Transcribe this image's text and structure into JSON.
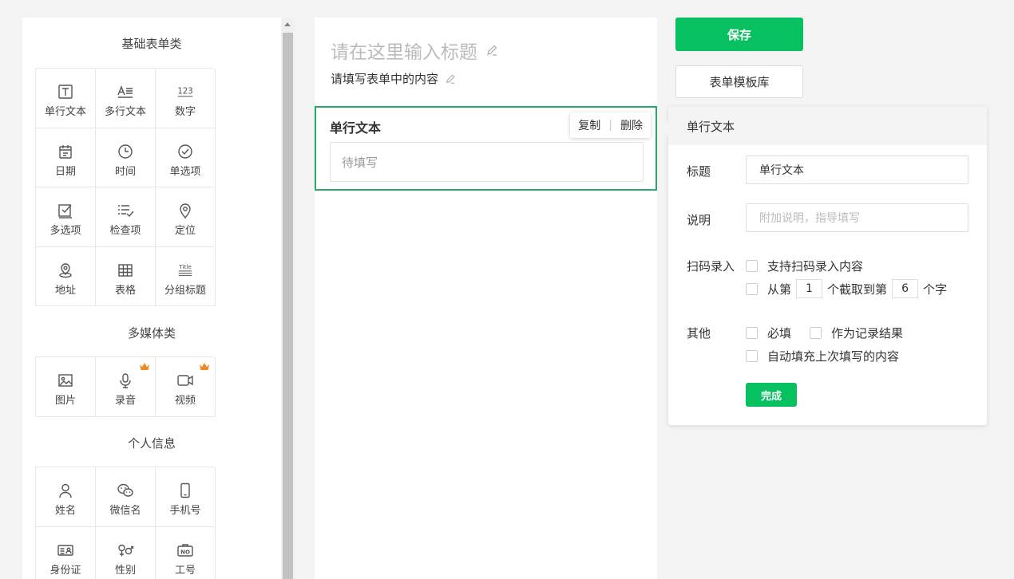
{
  "palette": {
    "sections": [
      {
        "title": "基础表单类",
        "items": [
          {
            "label": "单行文本",
            "icon": "text-box-icon"
          },
          {
            "label": "多行文本",
            "icon": "multiline-text-icon"
          },
          {
            "label": "数字",
            "icon": "number-icon"
          },
          {
            "label": "日期",
            "icon": "calendar-icon"
          },
          {
            "label": "时间",
            "icon": "clock-icon"
          },
          {
            "label": "单选项",
            "icon": "radio-check-icon"
          },
          {
            "label": "多选项",
            "icon": "checkbox-icon"
          },
          {
            "label": "检查项",
            "icon": "checklist-icon"
          },
          {
            "label": "定位",
            "icon": "location-pin-icon"
          },
          {
            "label": "地址",
            "icon": "address-pin-icon"
          },
          {
            "label": "表格",
            "icon": "table-icon"
          },
          {
            "label": "分组标题",
            "icon": "group-title-icon"
          }
        ]
      },
      {
        "title": "多媒体类",
        "items": [
          {
            "label": "图片",
            "icon": "image-icon"
          },
          {
            "label": "录音",
            "icon": "microphone-icon",
            "premium": true
          },
          {
            "label": "视频",
            "icon": "video-camera-icon",
            "premium": true
          }
        ]
      },
      {
        "title": "个人信息",
        "items": [
          {
            "label": "姓名",
            "icon": "person-icon"
          },
          {
            "label": "微信名",
            "icon": "wechat-icon"
          },
          {
            "label": "手机号",
            "icon": "phone-icon"
          },
          {
            "label": "身份证",
            "icon": "id-card-icon"
          },
          {
            "label": "性别",
            "icon": "gender-icon"
          },
          {
            "label": "工号",
            "icon": "badge-no-icon"
          }
        ]
      }
    ],
    "title_icon_text": "123",
    "group_icon_text": "Title",
    "badge_icon_text": "NO"
  },
  "canvas": {
    "title_placeholder": "请在这里输入标题",
    "description": "请填写表单中的内容",
    "field": {
      "label": "单行文本",
      "copy": "复制",
      "delete": "删除",
      "input_placeholder": "待填写"
    }
  },
  "toolbar": {
    "save": "保存",
    "template_library": "表单模板库"
  },
  "props": {
    "header": "单行文本",
    "title_label": "标题",
    "title_value": "单行文本",
    "desc_label": "说明",
    "desc_placeholder": "附加说明，指导填写",
    "scan_label": "扫码录入",
    "scan_support": "支持扫码录入内容",
    "scan_from": "从第",
    "scan_start": "1",
    "scan_mid": "个截取到第",
    "scan_end": "6",
    "scan_unit": "个字",
    "other_label": "其他",
    "required": "必填",
    "as_record": "作为记录结果",
    "autofill": "自动填充上次填写的内容",
    "done": "完成"
  },
  "colors": {
    "accent": "#07c160",
    "selected_border": "#2aa96b",
    "premium": "#f08a24"
  }
}
